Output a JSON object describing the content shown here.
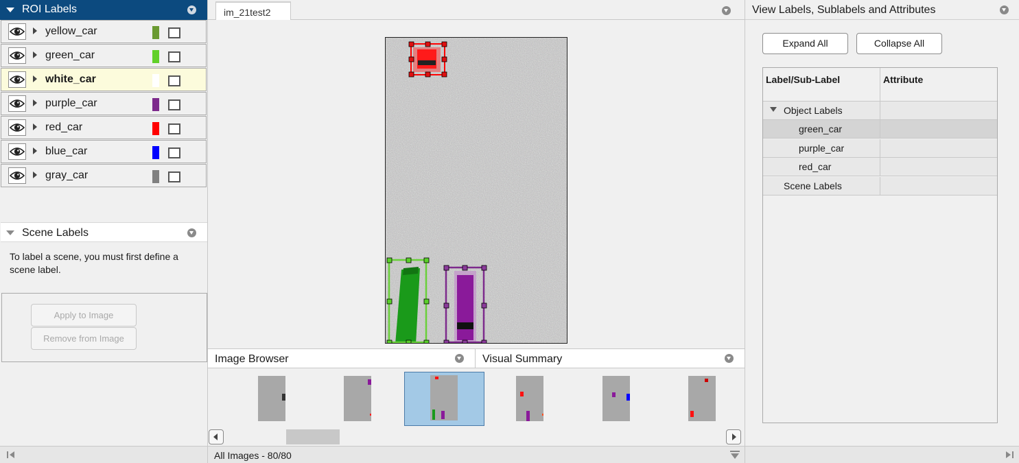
{
  "roi_panel": {
    "title": "ROI Labels",
    "labels": [
      {
        "name": "yellow_car",
        "color": "#6a9a32",
        "selected": false
      },
      {
        "name": "green_car",
        "color": "#61d028",
        "selected": false
      },
      {
        "name": "white_car",
        "color": "#ffffff",
        "selected": true
      },
      {
        "name": "purple_car",
        "color": "#7d2a8c",
        "selected": false
      },
      {
        "name": "red_car",
        "color": "#ff0000",
        "selected": false
      },
      {
        "name": "blue_car",
        "color": "#0000ff",
        "selected": false
      },
      {
        "name": "gray_car",
        "color": "#808080",
        "selected": false
      }
    ]
  },
  "scene_panel": {
    "title": "Scene Labels",
    "message": "To label a scene, you must first define a scene label.",
    "apply_label": "Apply to Image",
    "remove_label": "Remove from Image"
  },
  "document": {
    "tab_label": "im_21test2"
  },
  "image_browser": {
    "title": "Image Browser",
    "visual_summary_title": "Visual Summary"
  },
  "status_bar": {
    "text": "All Images - 80/80"
  },
  "attributes_panel": {
    "title": "View Labels, Sublabels and Attributes",
    "expand_all": "Expand All",
    "collapse_all": "Collapse All",
    "col_label": "Label/Sub-Label",
    "col_attribute": "Attribute",
    "object_labels": "Object Labels",
    "sublabels": [
      "green_car",
      "purple_car",
      "red_car"
    ],
    "scene_labels": "Scene Labels"
  },
  "colors": {
    "accent": "#0c4a7f",
    "selected_row": "#fcfbdc",
    "thumb_selected": "#a3c9e6"
  }
}
